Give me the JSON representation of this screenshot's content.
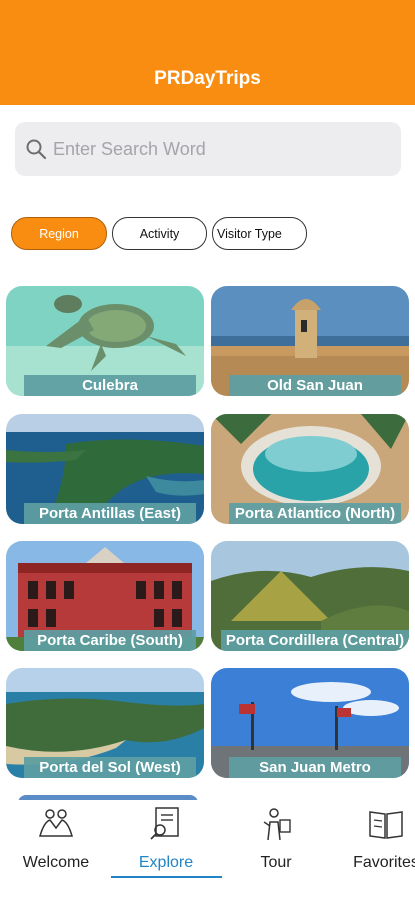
{
  "app": {
    "title": "PRDayTrips"
  },
  "search": {
    "placeholder": "Enter Search Word",
    "icon": "search-icon"
  },
  "filters": [
    {
      "label": "Region",
      "active": true
    },
    {
      "label": "Activity",
      "active": false
    },
    {
      "label": "Visitor Type",
      "active": false
    }
  ],
  "regions": [
    {
      "label": "Culebra"
    },
    {
      "label": "Old San Juan"
    },
    {
      "label": "Porta Antillas (East)"
    },
    {
      "label": "Porta Atlantico (North)"
    },
    {
      "label": "Porta Caribe (South)"
    },
    {
      "label": "Porta Cordillera (Central)"
    },
    {
      "label": "Porta del Sol (West)"
    },
    {
      "label": "San Juan Metro"
    }
  ],
  "tabs": [
    {
      "label": "Welcome",
      "icon": "welcome-icon"
    },
    {
      "label": "Explore",
      "icon": "explore-icon",
      "active": true
    },
    {
      "label": "Tour",
      "icon": "tour-icon"
    },
    {
      "label": "Favorites",
      "icon": "favorites-icon"
    }
  ],
  "colors": {
    "header": "#F88D12",
    "active_tab": "#2185c5",
    "label_bg": "#5E9EA2"
  }
}
